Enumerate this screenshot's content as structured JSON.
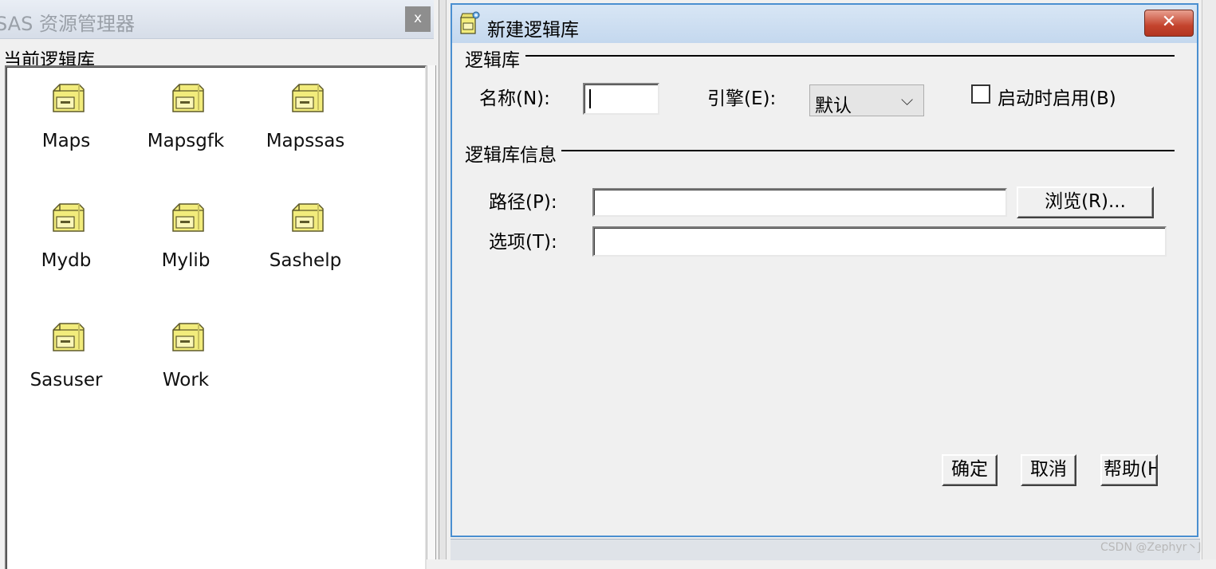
{
  "explorer": {
    "title": "SAS 资源管理器",
    "close_glyph": "x",
    "subtitle": "当前逻辑库",
    "libraries": [
      {
        "label": "Maps",
        "icon": "library-drawer-icon"
      },
      {
        "label": "Mapsgfk",
        "icon": "library-drawer-icon"
      },
      {
        "label": "Mapssas",
        "icon": "library-drawer-icon"
      },
      {
        "label": "Mydb",
        "icon": "library-drawer-icon"
      },
      {
        "label": "Mylib",
        "icon": "library-drawer-icon"
      },
      {
        "label": "Sashelp",
        "icon": "library-drawer-icon"
      },
      {
        "label": "Sasuser",
        "icon": "library-drawer-icon"
      },
      {
        "label": "Work",
        "icon": "library-drawer-icon"
      }
    ]
  },
  "dialog": {
    "title": "新建逻辑库",
    "close_glyph": "✕",
    "library_section": "逻辑库",
    "name_label": "名称(N):",
    "name_value": "",
    "engine_label": "引擎(E):",
    "engine_value": "默认",
    "engine_chevron": "⌵",
    "autostart_label": "启动时启用(B)",
    "autostart_checked": false,
    "info_section": "逻辑库信息",
    "path_label": "路径(P):",
    "path_value": "",
    "browse_button": "浏览(R)...",
    "options_label": "选项(T):",
    "options_value": "",
    "ok_button": "确定",
    "cancel_button": "取消",
    "help_button": "帮助(H)"
  },
  "watermark": "CSDN @Zephyr丶J",
  "colors": {
    "titlebar_blue": "#c4d8ee",
    "dialog_border": "#4a8fd0",
    "close_red": "#c4442e",
    "panel_bg": "#f0f0f0",
    "folder_yellow": "#f2ec7c"
  }
}
